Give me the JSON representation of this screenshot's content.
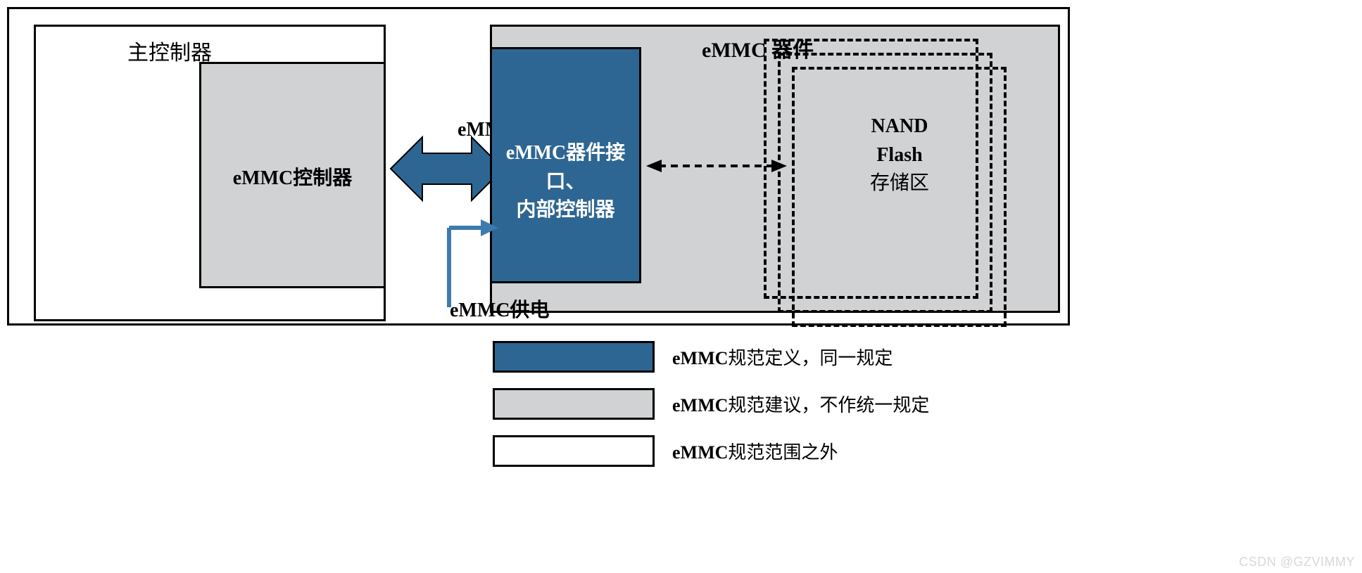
{
  "host": {
    "title": "主控制器",
    "controller_label": "eMMC控制器"
  },
  "bus": {
    "label": "eMMC总线"
  },
  "power": {
    "label": "eMMC供电"
  },
  "device": {
    "title": "eMMC 器件",
    "interface_label_1": "eMMC器件接口、",
    "interface_label_2": "内部控制器",
    "nand_label_1": "NAND",
    "nand_label_2": "Flash",
    "nand_label_3": "存储区"
  },
  "legend": {
    "item1_prefix": "eMMC",
    "item1_rest": "规范定义，同一规定",
    "item2_prefix": "eMMC",
    "item2_rest": "规范建议，不作统一规定",
    "item3_prefix": "eMMC",
    "item3_rest": "规范范围之外"
  },
  "watermark": "CSDN @GZVIMMY",
  "colors": {
    "blue": "#2e6693",
    "grey": "#d0d2d3",
    "arrow_blue": "#3d7bae"
  }
}
